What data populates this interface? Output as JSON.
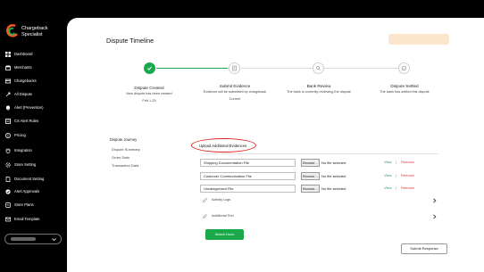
{
  "brand": {
    "line1": "Chargeback",
    "line2": "Specialist"
  },
  "sidebar": {
    "items": [
      {
        "label": "Dashboard",
        "icon": "grid-icon"
      },
      {
        "label": "Merchants",
        "icon": "store-icon"
      },
      {
        "label": "Chargebacks",
        "icon": "card-icon"
      },
      {
        "label": "All Dispute",
        "icon": "dispute-icon"
      },
      {
        "label": "Alert (Prevention)",
        "icon": "bell-icon"
      },
      {
        "label": "CS Alert Rules",
        "icon": "rules-icon"
      },
      {
        "label": "Pricing",
        "icon": "dollar-icon"
      },
      {
        "label": "Integration",
        "icon": "plug-icon"
      },
      {
        "label": "Store Setting",
        "icon": "settings-icon"
      },
      {
        "label": "Document Setting",
        "icon": "document-icon"
      },
      {
        "label": "Alert Approvals",
        "icon": "check-badge-icon"
      },
      {
        "label": "Store Plans",
        "icon": "plan-icon"
      },
      {
        "label": "Email Template",
        "icon": "mail-icon"
      }
    ]
  },
  "page": {
    "title": "Dispute Timeline"
  },
  "timeline": {
    "steps": [
      {
        "title": "Dispute Created",
        "sub": "New dispute has been created",
        "extra": "Feb 1-25",
        "state": "done"
      },
      {
        "title": "Submit Evidence",
        "sub": "Evidence will be submitted by chargeback",
        "extra": "Current",
        "state": "current"
      },
      {
        "title": "Bank Review",
        "sub": "The bank is currently reviewing the dispute",
        "extra": "",
        "state": "pending"
      },
      {
        "title": "Dispute Settled",
        "sub": "The bank has settled this dispute",
        "extra": "",
        "state": "pending"
      }
    ]
  },
  "journey": {
    "title": "Dispute Journey",
    "items": [
      "Dispute Summary",
      "Order Data",
      "Transaction Data"
    ]
  },
  "upload": {
    "link": "Upload Additional Evidences",
    "browse_label": "Browse...",
    "no_file": "No file selected",
    "view": "View",
    "separator": "|",
    "remove": "Remove",
    "files": [
      {
        "label": "Shipping Documentation File"
      },
      {
        "label": "Customer Communication File"
      },
      {
        "label": "Uncategorized File"
      }
    ]
  },
  "sections": {
    "activity_logs": "Activity Logs",
    "additional_text": "Additional Text"
  },
  "buttons": {
    "attach": "Attach Docs",
    "submit": "Submit Response"
  },
  "colors": {
    "accent_green": "#1aa84b",
    "highlight_red": "#e12020",
    "sidebar_bg": "#000000"
  }
}
